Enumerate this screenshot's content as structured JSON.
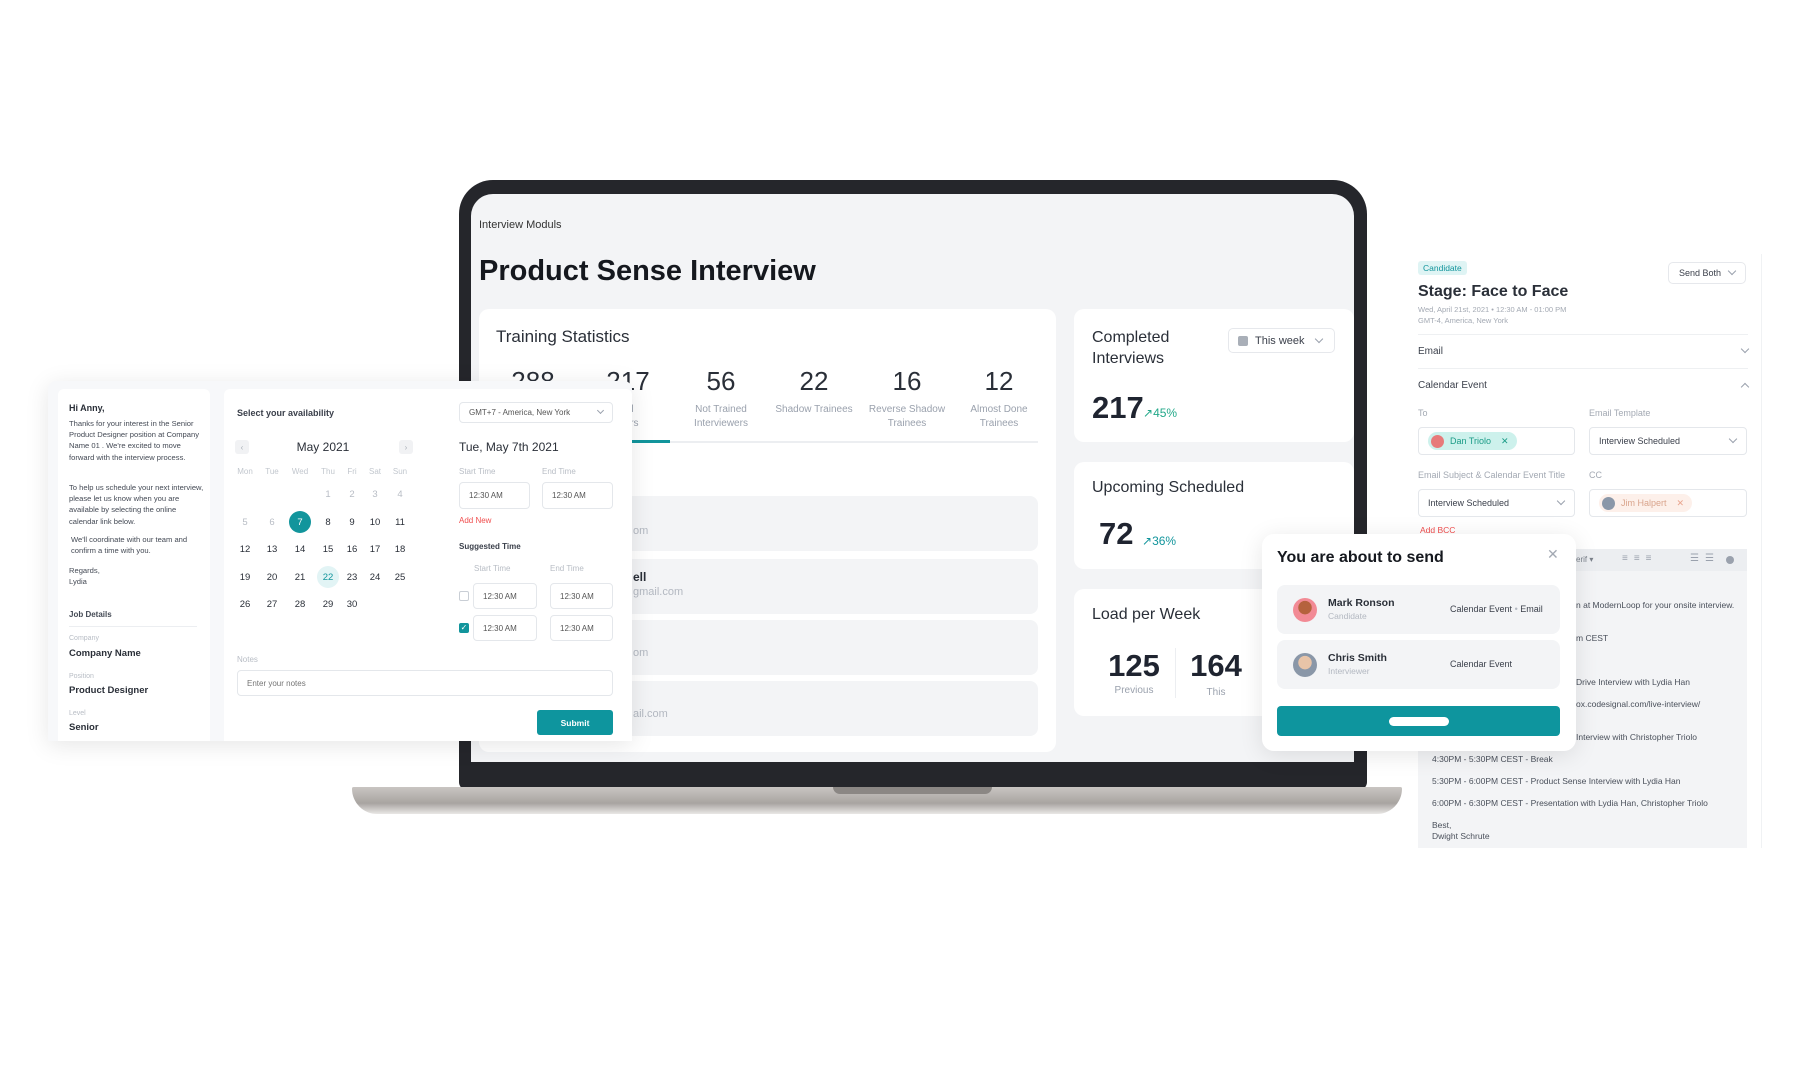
{
  "laptop": {
    "breadcrumb": "Interview Moduls",
    "title": "Product Sense Interview",
    "training": {
      "title": "Training Statistics",
      "stats": [
        {
          "value": "288",
          "label1": "",
          "label2": ""
        },
        {
          "value": "217",
          "label1": "ed",
          "label2": "wers"
        },
        {
          "value": "56",
          "label1": "Not Trained",
          "label2": "Interviewers"
        },
        {
          "value": "22",
          "label1": "Shadow Trainees",
          "label2": ""
        },
        {
          "value": "16",
          "label1": "Reverse Shadow",
          "label2": "Trainees"
        },
        {
          "value": "12",
          "label1": "Almost Done",
          "label2": "Trainees"
        }
      ],
      "rows": [
        {
          "name": "",
          "email": "om"
        },
        {
          "name": "ell",
          "email": "gmail.com"
        },
        {
          "name": "",
          "email": "om"
        },
        {
          "name": "",
          "email": "ail.com"
        }
      ]
    },
    "completed": {
      "title": "Completed Interviews",
      "value": "217",
      "change": "45%",
      "period": "This week"
    },
    "upcoming": {
      "title": "Upcoming Scheduled",
      "value": "72",
      "change": "36%"
    },
    "load": {
      "title": "Load per Week",
      "previous": "125",
      "previous_label": "Previous",
      "this": "164",
      "this_label": "This"
    }
  },
  "availability": {
    "greeting": "Hi Anny,",
    "para1": "Thanks for your interest in the Senior Product Designer position at Company Name 01 . We're excited to move forward with the interview process.",
    "para2": "To help us schedule your next interview, please let us know when you are available by selecting the online calendar link below.",
    "para3": "We'll coordinate with our team and confirm a time with you.",
    "regards": "Regards,",
    "signature": "Lydia",
    "job_details": "Job Details",
    "company_label": "Company",
    "company": "Company Name",
    "position_label": "Position",
    "position": "Product Designer",
    "level_label": "Level",
    "level": "Senior",
    "select_title": "Select your availability",
    "timezone": "GMT+7 - America, New York",
    "month": "May 2021",
    "weekdays": [
      "Mon",
      "Tue",
      "Wed",
      "Thu",
      "Fri",
      "Sat",
      "Sun"
    ],
    "weeks": [
      [
        "",
        "",
        "",
        "1",
        "2",
        "3",
        "4"
      ],
      [
        "5",
        "6",
        "7",
        "8",
        "9",
        "10",
        "11"
      ],
      [
        "12",
        "13",
        "14",
        "15",
        "16",
        "17",
        "18"
      ],
      [
        "19",
        "20",
        "21",
        "22",
        "23",
        "24",
        "25"
      ],
      [
        "26",
        "27",
        "28",
        "29",
        "30",
        "",
        ""
      ]
    ],
    "selected_day": "7",
    "today": "22",
    "selected_date": "Tue, May 7th 2021",
    "start_label": "Start Time",
    "end_label": "End Time",
    "start": "12:30 AM",
    "end": "12:30 AM",
    "add_new": "Add New",
    "suggested_title": "Suggested Time",
    "suggested": [
      {
        "start": "12:30 AM",
        "end": "12:30 AM",
        "checked": false
      },
      {
        "start": "12:30 AM",
        "end": "12:30 AM",
        "checked": true
      }
    ],
    "notes_label": "Notes",
    "notes_placeholder": "Enter your notes",
    "submit": "Submit"
  },
  "send_panel": {
    "badge": "Candidate",
    "send_mode": "Send Both",
    "title": "Stage: Face to Face",
    "datetime": "Wed, April 21st, 2021 • 12:30 AM - 01:00 PM",
    "timezone": "GMT-4, America, New York",
    "email_section": "Email",
    "calendar_section": "Calendar Event",
    "to_label": "To",
    "to": "Dan Triolo",
    "template_label": "Email Template",
    "template": "Interview Scheduled",
    "subject_label": "Email Subject & Calendar Event Title",
    "subject": "Interview Scheduled",
    "cc_label": "CC",
    "cc": "Jim Halpert",
    "add_bcc": "Add BCC",
    "font_menu": "erif",
    "body_fragments": [
      "n at ModernLoop for your onsite interview.",
      "m CEST",
      "Drive Interview with Lydia Han",
      "ox.codesignal.com/live-interview/",
      "Interview with Christopher Triolo"
    ],
    "body_lines": [
      "4:30PM - 5:30PM CEST - Break",
      "5:30PM - 6:00PM CEST - Product Sense Interview with Lydia Han",
      "6:00PM - 6:30PM CEST - Presentation with Lydia Han, Christopher Triolo",
      "Best,",
      "Dwight Schrute"
    ]
  },
  "modal": {
    "title": "You are about to send",
    "recipients": [
      {
        "name": "Mark Ronson",
        "role": "Candidate",
        "channels": "Calendar Event",
        "extra": "Email"
      },
      {
        "name": "Chris Smith",
        "role": "Interviewer",
        "channels": "Calendar Event",
        "extra": ""
      }
    ]
  },
  "colors": {
    "accent": "#12959c",
    "danger": "#f04d4d",
    "screen_bg": "#f3f4f6"
  }
}
